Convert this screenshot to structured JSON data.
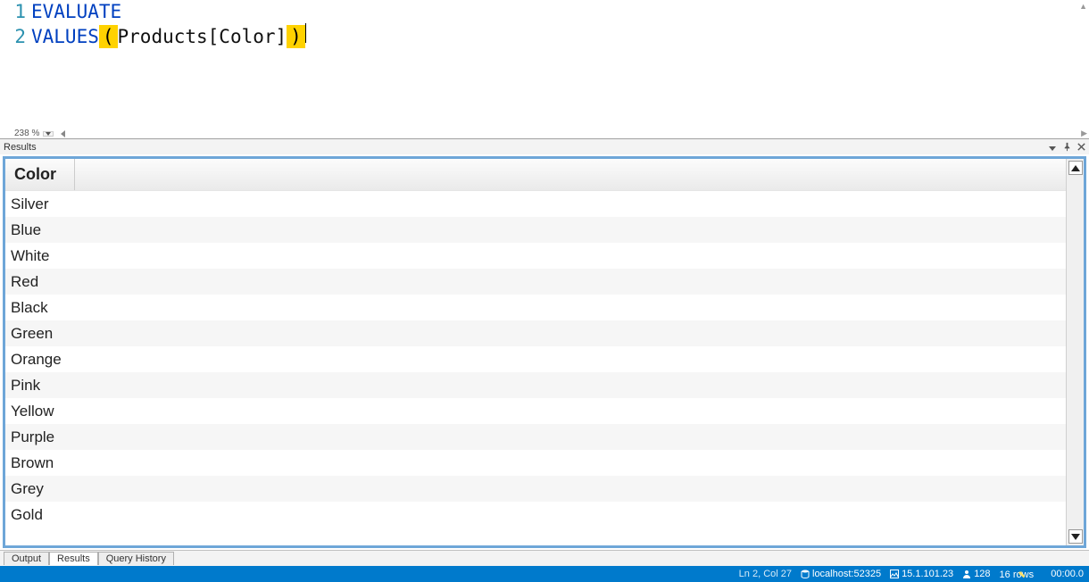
{
  "editor": {
    "lines": [
      {
        "num": "1",
        "tokens": [
          {
            "t": "EVALUATE",
            "cls": "tok-kw"
          }
        ]
      },
      {
        "num": "2",
        "tokens": [
          {
            "t": "VALUES",
            "cls": "tok-kw"
          },
          {
            "t": " ",
            "cls": "tok-txt"
          },
          {
            "t": "(",
            "cls": "tok-paren"
          },
          {
            "t": " Products[Color] ",
            "cls": "tok-txt"
          },
          {
            "t": ")",
            "cls": "tok-paren"
          }
        ]
      }
    ],
    "zoom": "238 %"
  },
  "results": {
    "panel_title": "Results",
    "column_header": "Color",
    "rows": [
      "Silver",
      "Blue",
      "White",
      "Red",
      "Black",
      "Green",
      "Orange",
      "Pink",
      "Yellow",
      "Purple",
      "Brown",
      "Grey",
      "Gold"
    ]
  },
  "bottom_tabs": {
    "items": [
      "Output",
      "Results",
      "Query History"
    ],
    "active_index": 1
  },
  "status": {
    "ln_col": "Ln 2, Col 27",
    "server": "localhost:52325",
    "version": "15.1.101.23",
    "spid": "128",
    "rows": "16 rows",
    "time": "00:00.0"
  }
}
